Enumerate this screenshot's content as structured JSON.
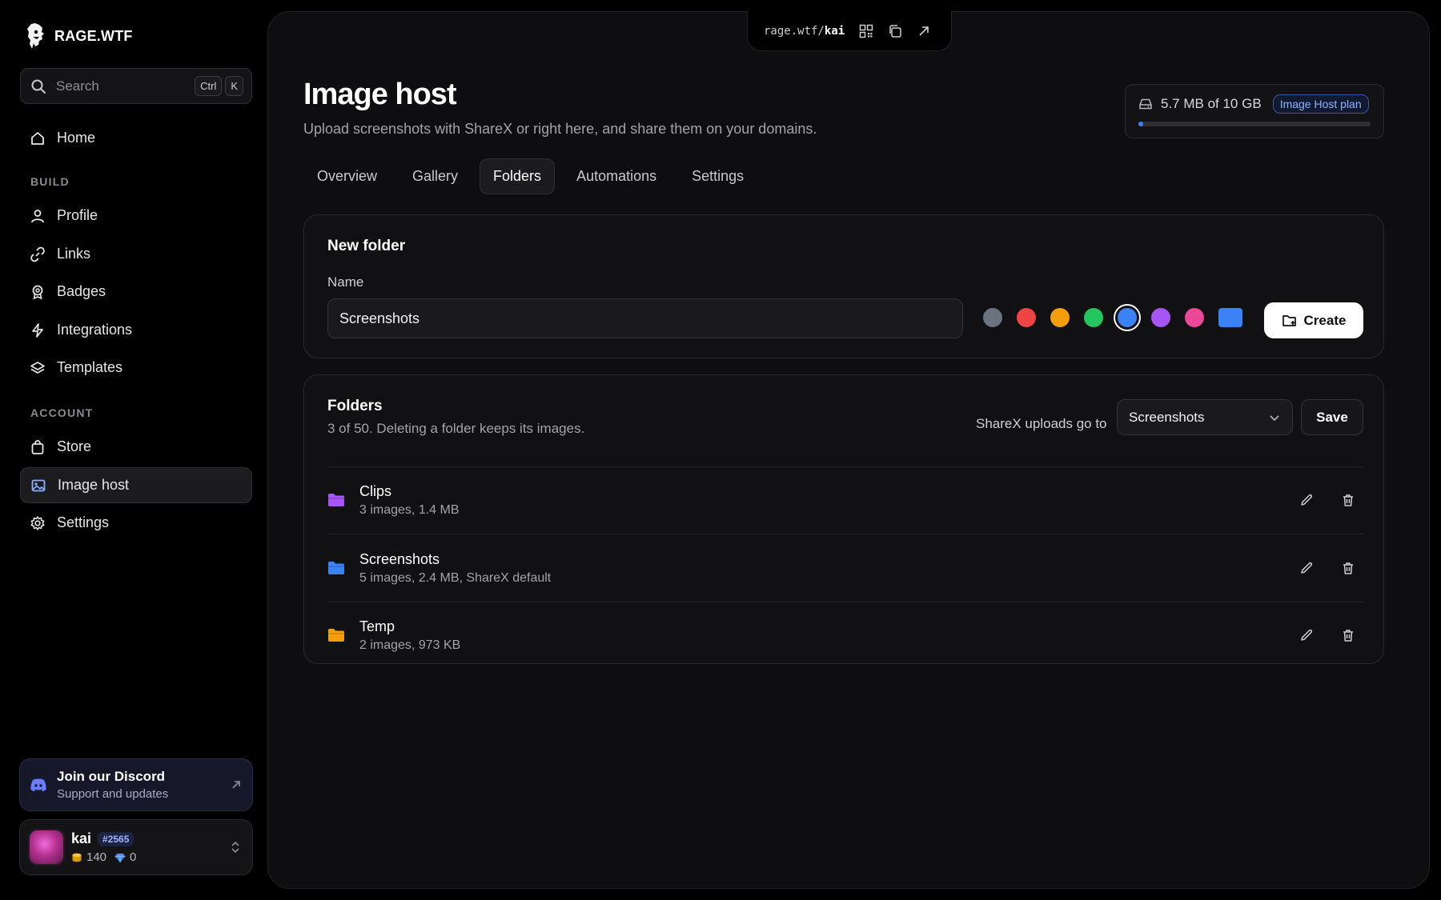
{
  "brand": {
    "name": "RAGE.WTF"
  },
  "search": {
    "placeholder": "Search",
    "kbd1": "Ctrl",
    "kbd2": "K"
  },
  "nav": {
    "home": "Home",
    "build_section": "BUILD",
    "build_items": [
      "Profile",
      "Links",
      "Badges",
      "Integrations",
      "Templates"
    ],
    "account_section": "ACCOUNT",
    "account_items": [
      "Store",
      "Image host",
      "Settings"
    ]
  },
  "discord": {
    "title": "Join our Discord",
    "subtitle": "Support and updates"
  },
  "user": {
    "name": "kai",
    "tag": "#2565",
    "coins": "140",
    "gems": "0"
  },
  "urlbar": {
    "prefix": "rage.wtf/",
    "handle": "kai"
  },
  "page": {
    "title": "Image host",
    "subtitle": "Upload screenshots with ShareX or right here, and share them on your domains."
  },
  "storage": {
    "used_text": "5.7 MB of 10 GB",
    "plan": "Image Host plan",
    "used_fraction": 0.00057
  },
  "tabs": [
    "Overview",
    "Gallery",
    "Folders",
    "Automations",
    "Settings"
  ],
  "active_tab": "Folders",
  "new_folder": {
    "title": "New folder",
    "name_label": "Name",
    "name_value": "Screenshots",
    "colors": [
      "#6b7280",
      "#ef4444",
      "#f59e0b",
      "#22c55e",
      "#3b82f6",
      "#a855f7",
      "#ec4899",
      "#3b82f6"
    ],
    "selected_color_index": 4,
    "create_label": "Create"
  },
  "folders": {
    "title": "Folders",
    "subtitle": "3 of 50. Deleting a folder keeps its images.",
    "sharex_label": "ShareX uploads go to",
    "sharex_target": "Screenshots",
    "save_label": "Save",
    "items": [
      {
        "name": "Clips",
        "meta": "3 images, 1.4 MB",
        "color": "#a855f7"
      },
      {
        "name": "Screenshots",
        "meta": "5 images, 2.4 MB, ShareX default",
        "color": "#3b82f6"
      },
      {
        "name": "Temp",
        "meta": "2 images, 973 KB",
        "color": "#f59e0b"
      }
    ]
  }
}
